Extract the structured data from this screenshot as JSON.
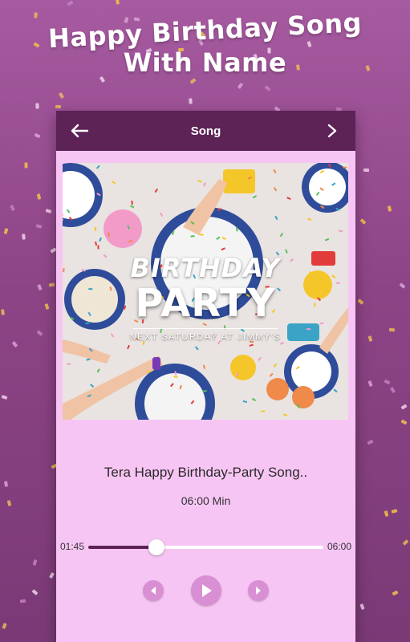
{
  "headline": {
    "line1": "Happy Birthday Song",
    "line2": "With Name"
  },
  "appbar": {
    "title": "Song",
    "back_icon": "arrow-left-icon",
    "forward_icon": "chevron-right-icon"
  },
  "cover": {
    "word1": "BIRTHDAY",
    "word2": "PARTY",
    "subtitle": "NEXT SATURDAY AT JIMMY'S"
  },
  "song": {
    "title": "Tera Happy Birthday-Party Song..",
    "duration": "06:00 Min"
  },
  "player": {
    "elapsed": "01:45",
    "total": "06:00",
    "progress": 0.29,
    "controls": [
      "prev-icon",
      "play-icon",
      "next-icon"
    ]
  },
  "colors": {
    "background": "#8d4486",
    "appbar": "#5d2357",
    "panel": "#f7c5f4",
    "control": "#d98fd3"
  }
}
